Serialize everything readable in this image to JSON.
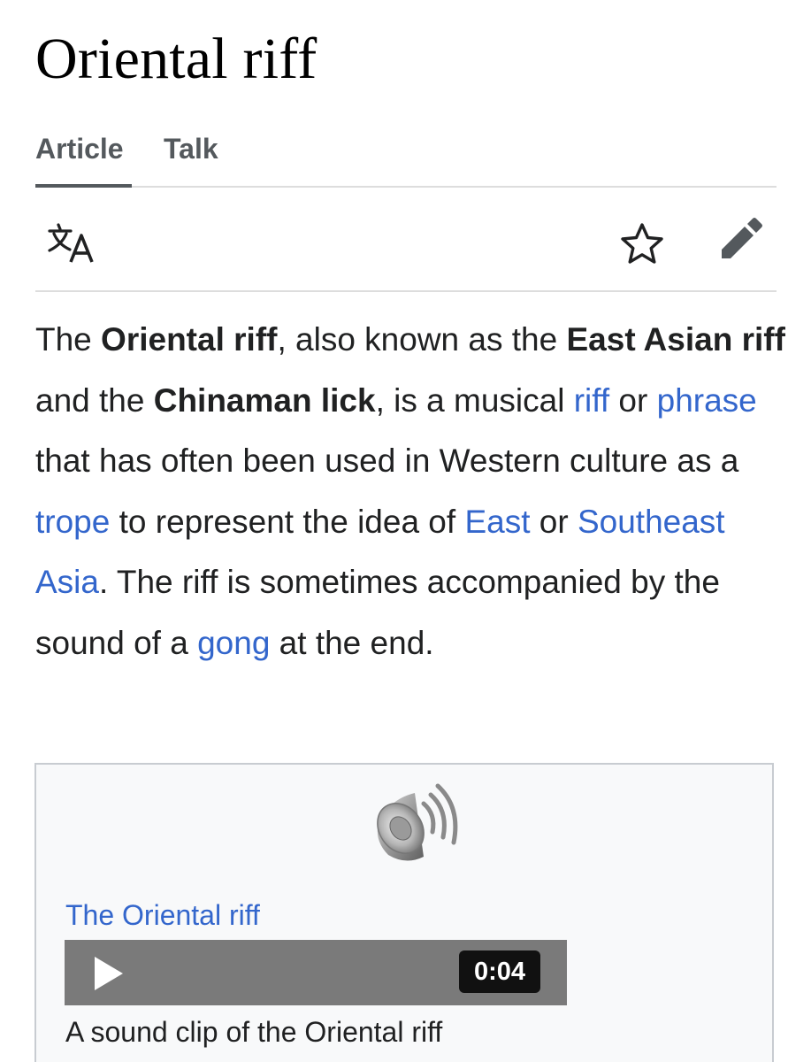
{
  "page": {
    "title": "Oriental riff"
  },
  "tabs": [
    {
      "label": "Article",
      "selected": true
    },
    {
      "label": "Talk",
      "selected": false
    }
  ],
  "toolbar": {
    "icons": [
      "language-icon",
      "star-icon",
      "edit-pencil-icon"
    ]
  },
  "lead": {
    "segments": [
      {
        "type": "text",
        "text": "The "
      },
      {
        "type": "bold",
        "text": "Oriental riff"
      },
      {
        "type": "text",
        "text": ", also known as the "
      },
      {
        "type": "bold",
        "text": "East Asian riff"
      },
      {
        "type": "text",
        "text": " and the "
      },
      {
        "type": "bold",
        "text": "Chinaman lick"
      },
      {
        "type": "text",
        "text": ", is a musical "
      },
      {
        "type": "link",
        "text": "riff"
      },
      {
        "type": "text",
        "text": " or "
      },
      {
        "type": "link",
        "text": "phrase"
      },
      {
        "type": "text",
        "text": " that has often been used in Western culture as a "
      },
      {
        "type": "link",
        "text": "trope"
      },
      {
        "type": "text",
        "text": " to represent the idea of "
      },
      {
        "type": "link",
        "text": "East"
      },
      {
        "type": "text",
        "text": " or "
      },
      {
        "type": "link",
        "text": "Southeast Asia"
      },
      {
        "type": "text",
        "text": ". The riff is sometimes accompanied by the sound of a "
      },
      {
        "type": "link",
        "text": "gong"
      },
      {
        "type": "text",
        "text": " at the end."
      }
    ]
  },
  "media": {
    "icon": "speaker-icon",
    "link_label": "The Oriental riff",
    "player": {
      "play_icon": "play-icon",
      "duration": "0:04"
    },
    "caption": "A sound clip of the Oriental riff"
  },
  "colors": {
    "link": "#3366cc",
    "text": "#202122",
    "tab_text": "#54595d",
    "divider": "#dddddd",
    "media_bg": "#f8f9fa",
    "player_bg": "#7a7a7a"
  }
}
